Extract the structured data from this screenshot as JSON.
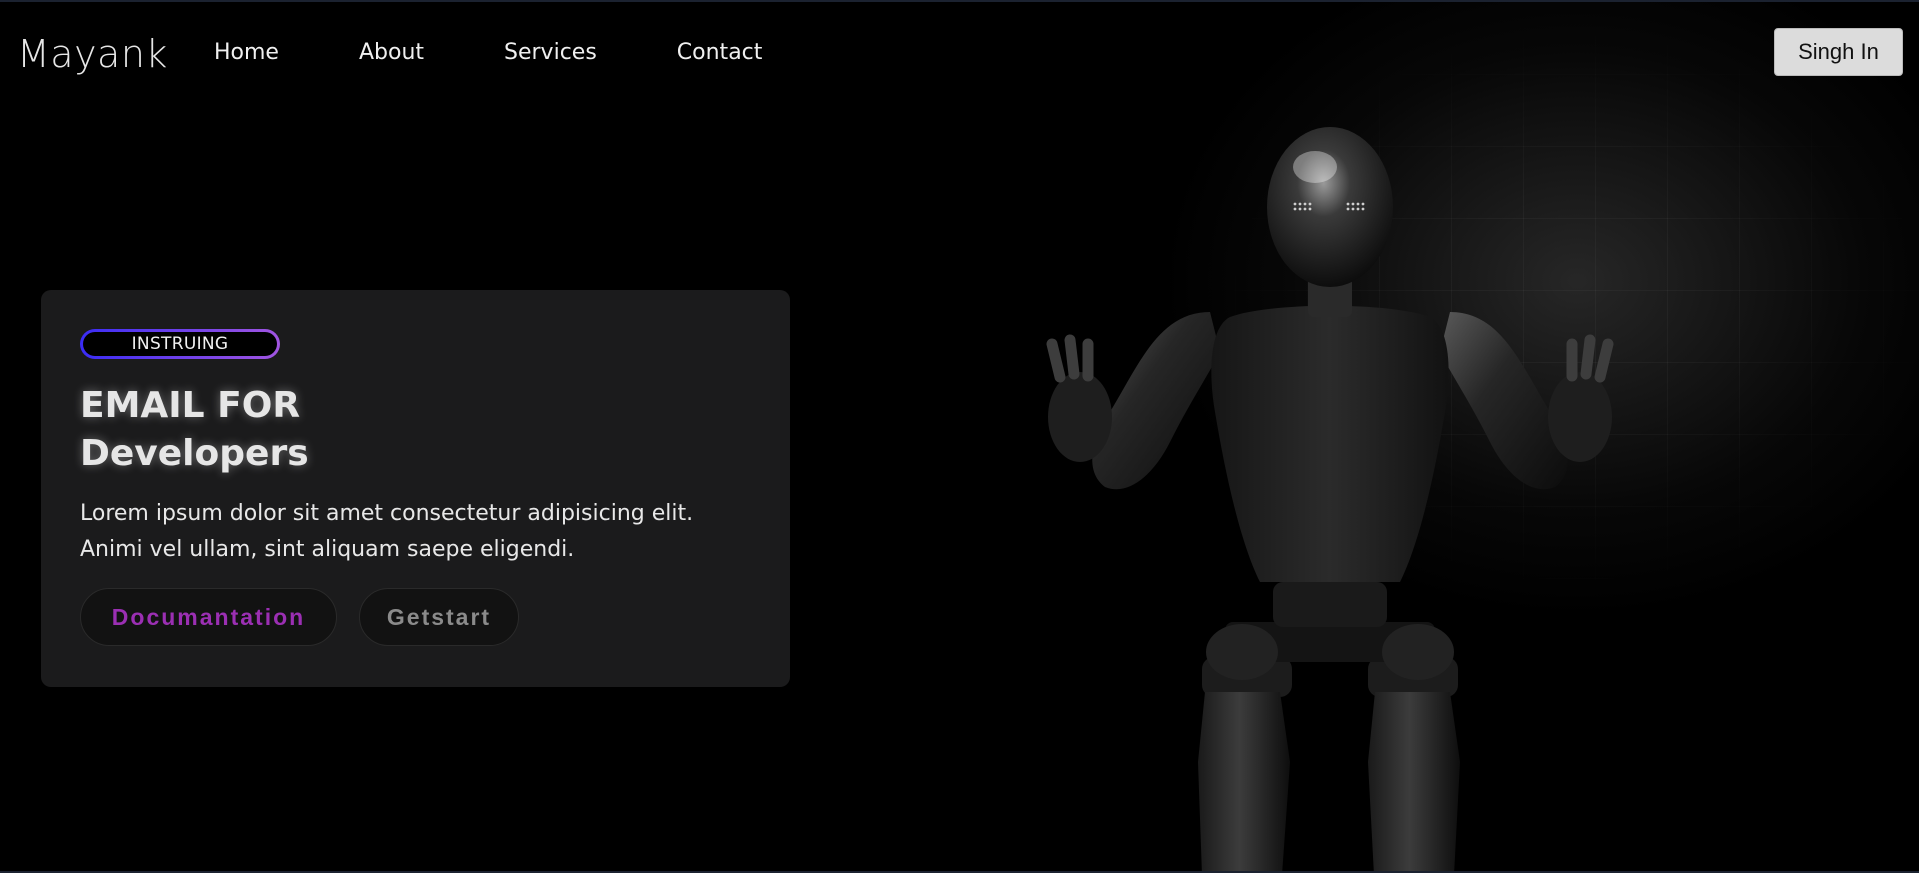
{
  "nav": {
    "logo": "Mayank",
    "links": [
      {
        "label": "Home"
      },
      {
        "label": "About"
      },
      {
        "label": "Services"
      },
      {
        "label": "Contact"
      }
    ],
    "signin_label": "Singh In"
  },
  "hero": {
    "badge": "INSTRUING",
    "title_line1": "EMAIL FOR",
    "title_line2": "Developers",
    "description": "Lorem ipsum dolor sit amet consectetur adipisicing elit. Animi vel ullam, sint aliquam saepe eligendi.",
    "buttons": {
      "documentation": "Documantation",
      "getstart": "Getstart"
    }
  },
  "colors": {
    "background": "#000000",
    "card": "#1b1b1c",
    "badge_gradient_start": "#3a2cf5",
    "badge_gradient_end": "#a155e0",
    "documentation_text": "#9b2fb3",
    "getstart_text": "#8b8b8b"
  },
  "illustration": {
    "subject": "robot-illustration"
  }
}
